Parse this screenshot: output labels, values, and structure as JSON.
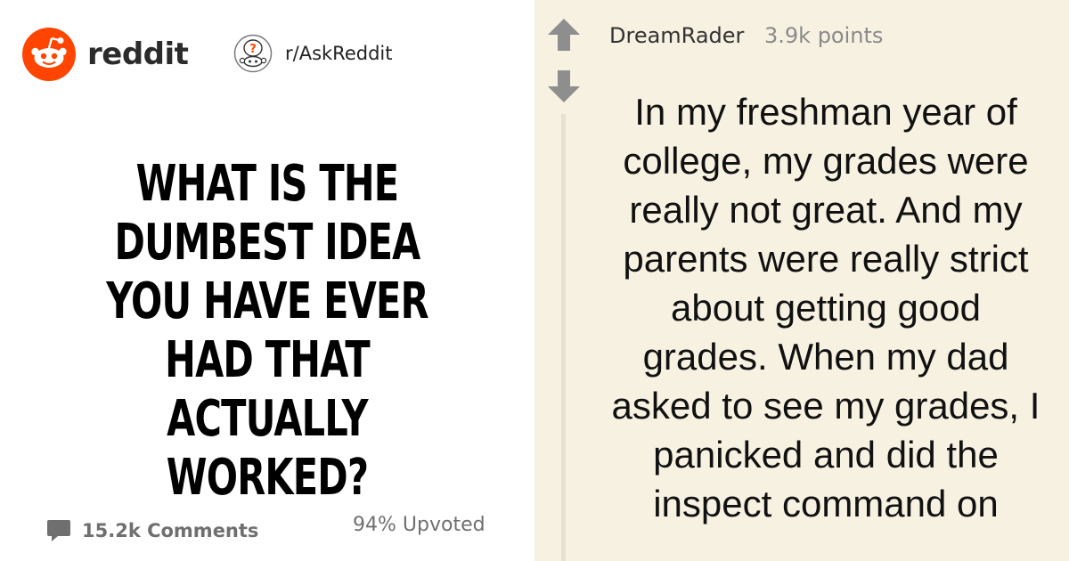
{
  "brand": {
    "name": "reddit",
    "accent": "#ff4500"
  },
  "subreddit": {
    "name": "r/AskReddit"
  },
  "post": {
    "title": "What is the dumbest idea you have ever had that actually worked?",
    "comments_label": "15.2k Comments",
    "upvoted_label": "94% Upvoted"
  },
  "comment": {
    "author": "DreamRader",
    "points": "3.9k points",
    "body": "In my freshman year of college, my grades were really not great. And my parents were really strict about getting good grades. When my dad asked to see my grades, I panicked and did the inspect command on"
  },
  "icons": {
    "brand_logo": "reddit-snoo-icon",
    "subreddit_icon": "askreddit-snoo-icon",
    "comments": "speech-bubble-icon",
    "upvote": "arrow-up-icon",
    "downvote": "arrow-down-icon"
  }
}
